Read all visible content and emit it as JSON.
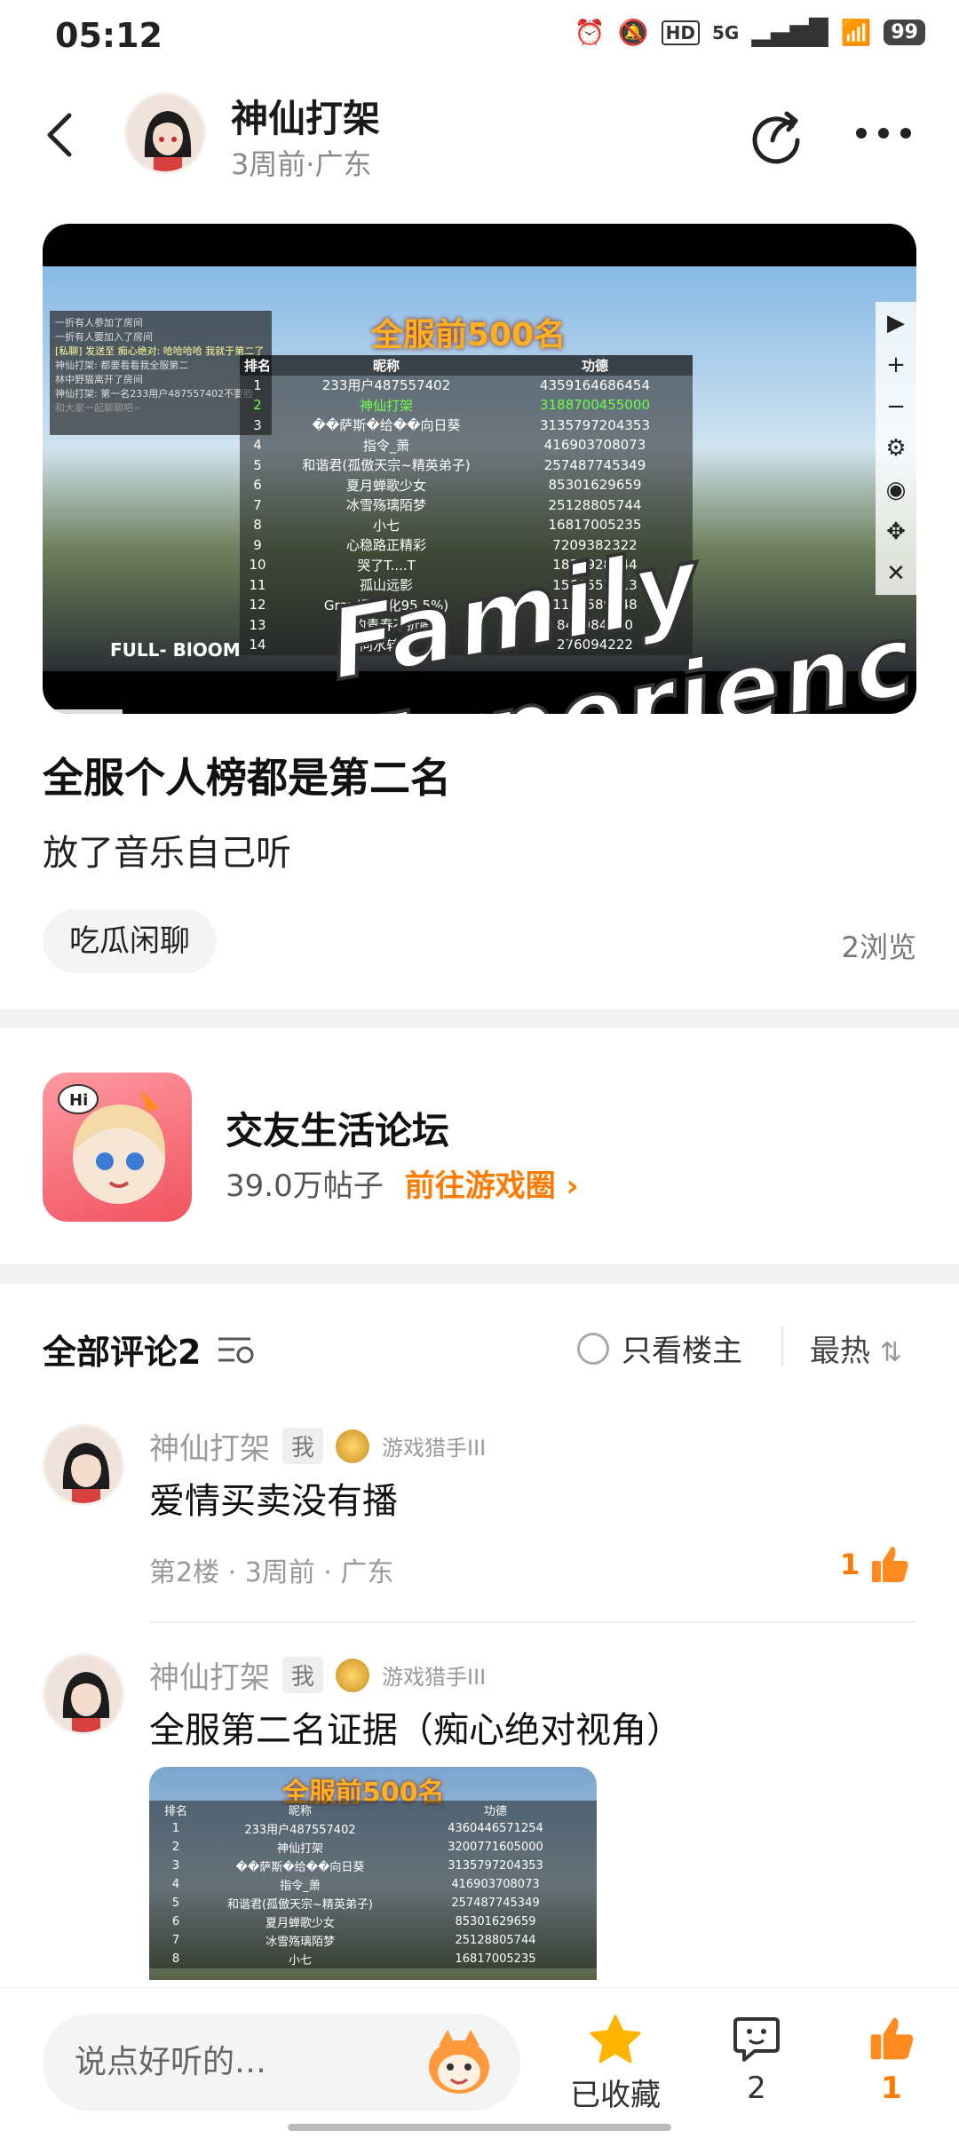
{
  "status": {
    "time": "05:12",
    "network": "5G",
    "battery": "99"
  },
  "header": {
    "author": "神仙打架",
    "subtitle": "3周前·广东"
  },
  "video": {
    "title": "全服前500名",
    "columns": [
      "排名",
      "昵称",
      "功德"
    ],
    "rows": [
      [
        "1",
        "233用户487557402",
        "4359164686454"
      ],
      [
        "2",
        "神仙打架",
        "3188700455000"
      ],
      [
        "3",
        "��萨斯�给��向日葵",
        "3135797204353"
      ],
      [
        "4",
        "指令_萧",
        "416903708073"
      ],
      [
        "5",
        "和谐君(孤傲天宗~精英弟子)",
        "257487745349"
      ],
      [
        "6",
        "夏月蝉歌少女",
        "85301629659"
      ],
      [
        "7",
        "冰雪殇璃陌梦",
        "25128805744"
      ],
      [
        "8",
        "小七",
        "16817005235"
      ],
      [
        "9",
        "心稳路正精彩",
        "7209382322"
      ],
      [
        "10",
        "哭了T....T",
        "1837928144"
      ],
      [
        "11",
        "孤山远影",
        "1569551013"
      ],
      [
        "12",
        "Gray(已黑化95.5%)",
        "1182589148"
      ],
      [
        "13",
        "谁的青春不折腾",
        "849984000"
      ],
      [
        "14",
        "问水转寒",
        "276094222"
      ]
    ],
    "overlay_text": "Family Experience",
    "badge": "FULL- BlOOM",
    "chat_lines": [
      "一折有人参加了房间",
      "一折有人要加入了房间",
      "[私聊] 发送至 痴心绝对: 哈哈哈哈 我就于第二了",
      "神仙打架: 都要看看我全服第二",
      "林中野猫离开了房间",
      "神仙打架: 第一名233用户487557402不要脸"
    ],
    "chat_placeholder": "和大家一起聊聊吧~"
  },
  "post": {
    "title": "全服个人榜都是第二名",
    "body": "放了音乐自己听",
    "tag": "吃瓜闲聊",
    "views": "2浏览"
  },
  "forum": {
    "name": "交友生活论坛",
    "posts": "39.0万帖子",
    "link": "前往游戏圈"
  },
  "comments_section": {
    "title": "全部评论2",
    "only_op": "只看楼主",
    "sort": "最热"
  },
  "comments": [
    {
      "name": "神仙打架",
      "badge": "我",
      "title": "游戏猎手III",
      "text": "爱情买卖没有播",
      "meta": "第2楼 · 3周前 · 广东",
      "likes": "1"
    },
    {
      "name": "神仙打架",
      "badge": "我",
      "title": "游戏猎手III",
      "text": "全服第二名证据（痴心绝对视角）"
    }
  ],
  "comment_image": {
    "title": "全服前500名",
    "rows": [
      [
        "排名",
        "昵称",
        "功德"
      ],
      [
        "1",
        "233用户487557402",
        "4360446571254"
      ],
      [
        "2",
        "神仙打架",
        "3200771605000"
      ],
      [
        "3",
        "��萨斯�给��向日葵",
        "3135797204353"
      ],
      [
        "4",
        "指令_萧",
        "416903708073"
      ],
      [
        "5",
        "和谐君(孤傲天宗~精英弟子)",
        "257487745349"
      ],
      [
        "6",
        "夏月蝉歌少女",
        "85301629659"
      ],
      [
        "7",
        "冰雪殇璃陌梦",
        "25128805744"
      ],
      [
        "8",
        "小七",
        "16817005235"
      ]
    ]
  },
  "bottom_bar": {
    "placeholder": "说点好听的…",
    "favorite": "已收藏",
    "comments": "2",
    "likes": "1"
  },
  "colors": {
    "accent": "#ff7a00",
    "like": "#ff8a1f",
    "star": "#ffb400"
  }
}
